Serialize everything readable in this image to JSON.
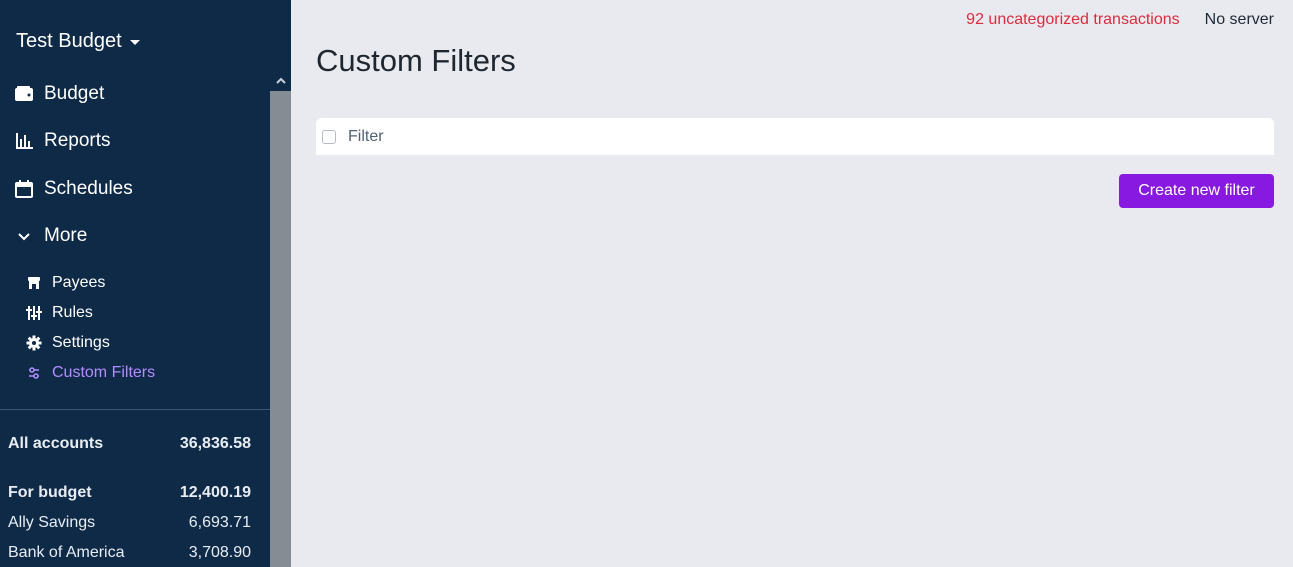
{
  "sidebar": {
    "budget_name": "Test Budget",
    "nav": [
      {
        "label": "Budget",
        "icon": "wallet-icon"
      },
      {
        "label": "Reports",
        "icon": "bar-chart-icon"
      },
      {
        "label": "Schedules",
        "icon": "calendar-icon"
      },
      {
        "label": "More",
        "icon": "chevron-down-icon"
      }
    ],
    "more_items": [
      {
        "label": "Payees",
        "icon": "storefront-icon"
      },
      {
        "label": "Rules",
        "icon": "sliders-icon"
      },
      {
        "label": "Settings",
        "icon": "gear-icon"
      },
      {
        "label": "Custom Filters",
        "icon": "filter-sliders-icon",
        "active": true
      }
    ],
    "accounts": {
      "all": {
        "label": "All accounts",
        "balance": "36,836.58"
      },
      "for_budget": {
        "label": "For budget",
        "balance": "12,400.19"
      },
      "items": [
        {
          "label": "Ally Savings",
          "balance": "6,693.71"
        },
        {
          "label": "Bank of America",
          "balance": "3,708.90"
        }
      ]
    }
  },
  "header": {
    "uncategorized": "92 uncategorized transactions",
    "server": "No server"
  },
  "main": {
    "title": "Custom Filters",
    "table_header": "Filter",
    "create_button": "Create new filter"
  },
  "colors": {
    "sidebar_bg": "#0e2a47",
    "accent": "#8719e0",
    "active_link": "#b38cff",
    "warning": "#dc2c3e"
  }
}
